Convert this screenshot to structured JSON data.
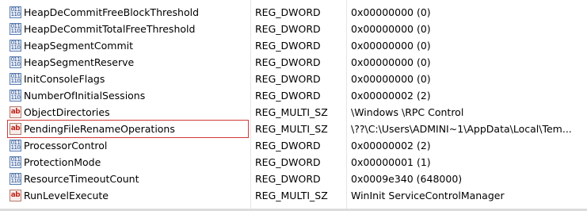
{
  "values": [
    {
      "name": "HeapDeCommitFreeBlockThreshold",
      "type": "REG_DWORD",
      "data": "0x00000000 (0)",
      "icon": "binary-value-icon"
    },
    {
      "name": "HeapDeCommitTotalFreeThreshold",
      "type": "REG_DWORD",
      "data": "0x00000000 (0)",
      "icon": "binary-value-icon"
    },
    {
      "name": "HeapSegmentCommit",
      "type": "REG_DWORD",
      "data": "0x00000000 (0)",
      "icon": "binary-value-icon"
    },
    {
      "name": "HeapSegmentReserve",
      "type": "REG_DWORD",
      "data": "0x00000000 (0)",
      "icon": "binary-value-icon"
    },
    {
      "name": "InitConsoleFlags",
      "type": "REG_DWORD",
      "data": "0x00000000 (0)",
      "icon": "binary-value-icon"
    },
    {
      "name": "NumberOfInitialSessions",
      "type": "REG_DWORD",
      "data": "0x00000002 (2)",
      "icon": "binary-value-icon"
    },
    {
      "name": "ObjectDirectories",
      "type": "REG_MULTI_SZ",
      "data": "\\Windows \\RPC Control",
      "icon": "string-value-icon"
    },
    {
      "name": "PendingFileRenameOperations",
      "type": "REG_MULTI_SZ",
      "data": "\\??\\C:\\Users\\ADMINI~1\\AppData\\Local\\Tem...",
      "icon": "string-value-icon",
      "highlighted": true
    },
    {
      "name": "ProcessorControl",
      "type": "REG_DWORD",
      "data": "0x00000002 (2)",
      "icon": "binary-value-icon"
    },
    {
      "name": "ProtectionMode",
      "type": "REG_DWORD",
      "data": "0x00000001 (1)",
      "icon": "binary-value-icon"
    },
    {
      "name": "ResourceTimeoutCount",
      "type": "REG_DWORD",
      "data": "0x0009e340 (648000)",
      "icon": "binary-value-icon"
    },
    {
      "name": "RunLevelExecute",
      "type": "REG_MULTI_SZ",
      "data": "WinInit ServiceControlManager",
      "icon": "string-value-icon"
    }
  ],
  "icon_glyphs": {
    "binary": "011 110",
    "string": "ab"
  },
  "colors": {
    "highlight_border": "#d23a3a"
  }
}
